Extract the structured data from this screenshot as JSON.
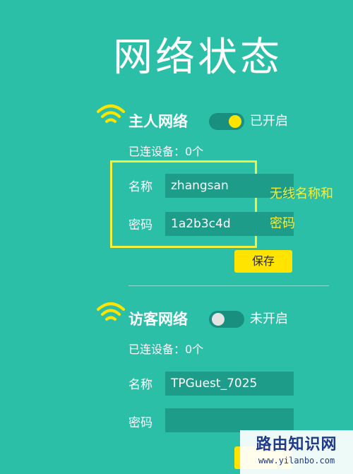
{
  "page": {
    "title": "网络状态"
  },
  "host_network": {
    "title": "主人网络",
    "toggle_state": "已开启",
    "connected_devices": "已连设备：0个",
    "name_label": "名称",
    "name_value": "zhangsan",
    "password_label": "密码",
    "password_value": "1a2b3c4d",
    "save_label": "保存"
  },
  "annotation": {
    "line1": "无线名称和",
    "line2": "密码"
  },
  "guest_network": {
    "title": "访客网络",
    "toggle_state": "未开启",
    "connected_devices": "已连设备：0个",
    "name_label": "名称",
    "name_value": "TPGuest_7025",
    "password_label": "密码",
    "password_value": ""
  },
  "watermark": {
    "text": "路由知识网",
    "url": "www.yilanbo.com"
  },
  "colors": {
    "background": "#2cbfa8",
    "accent_yellow": "#ffe400",
    "input_bg": "#1c9c89"
  }
}
